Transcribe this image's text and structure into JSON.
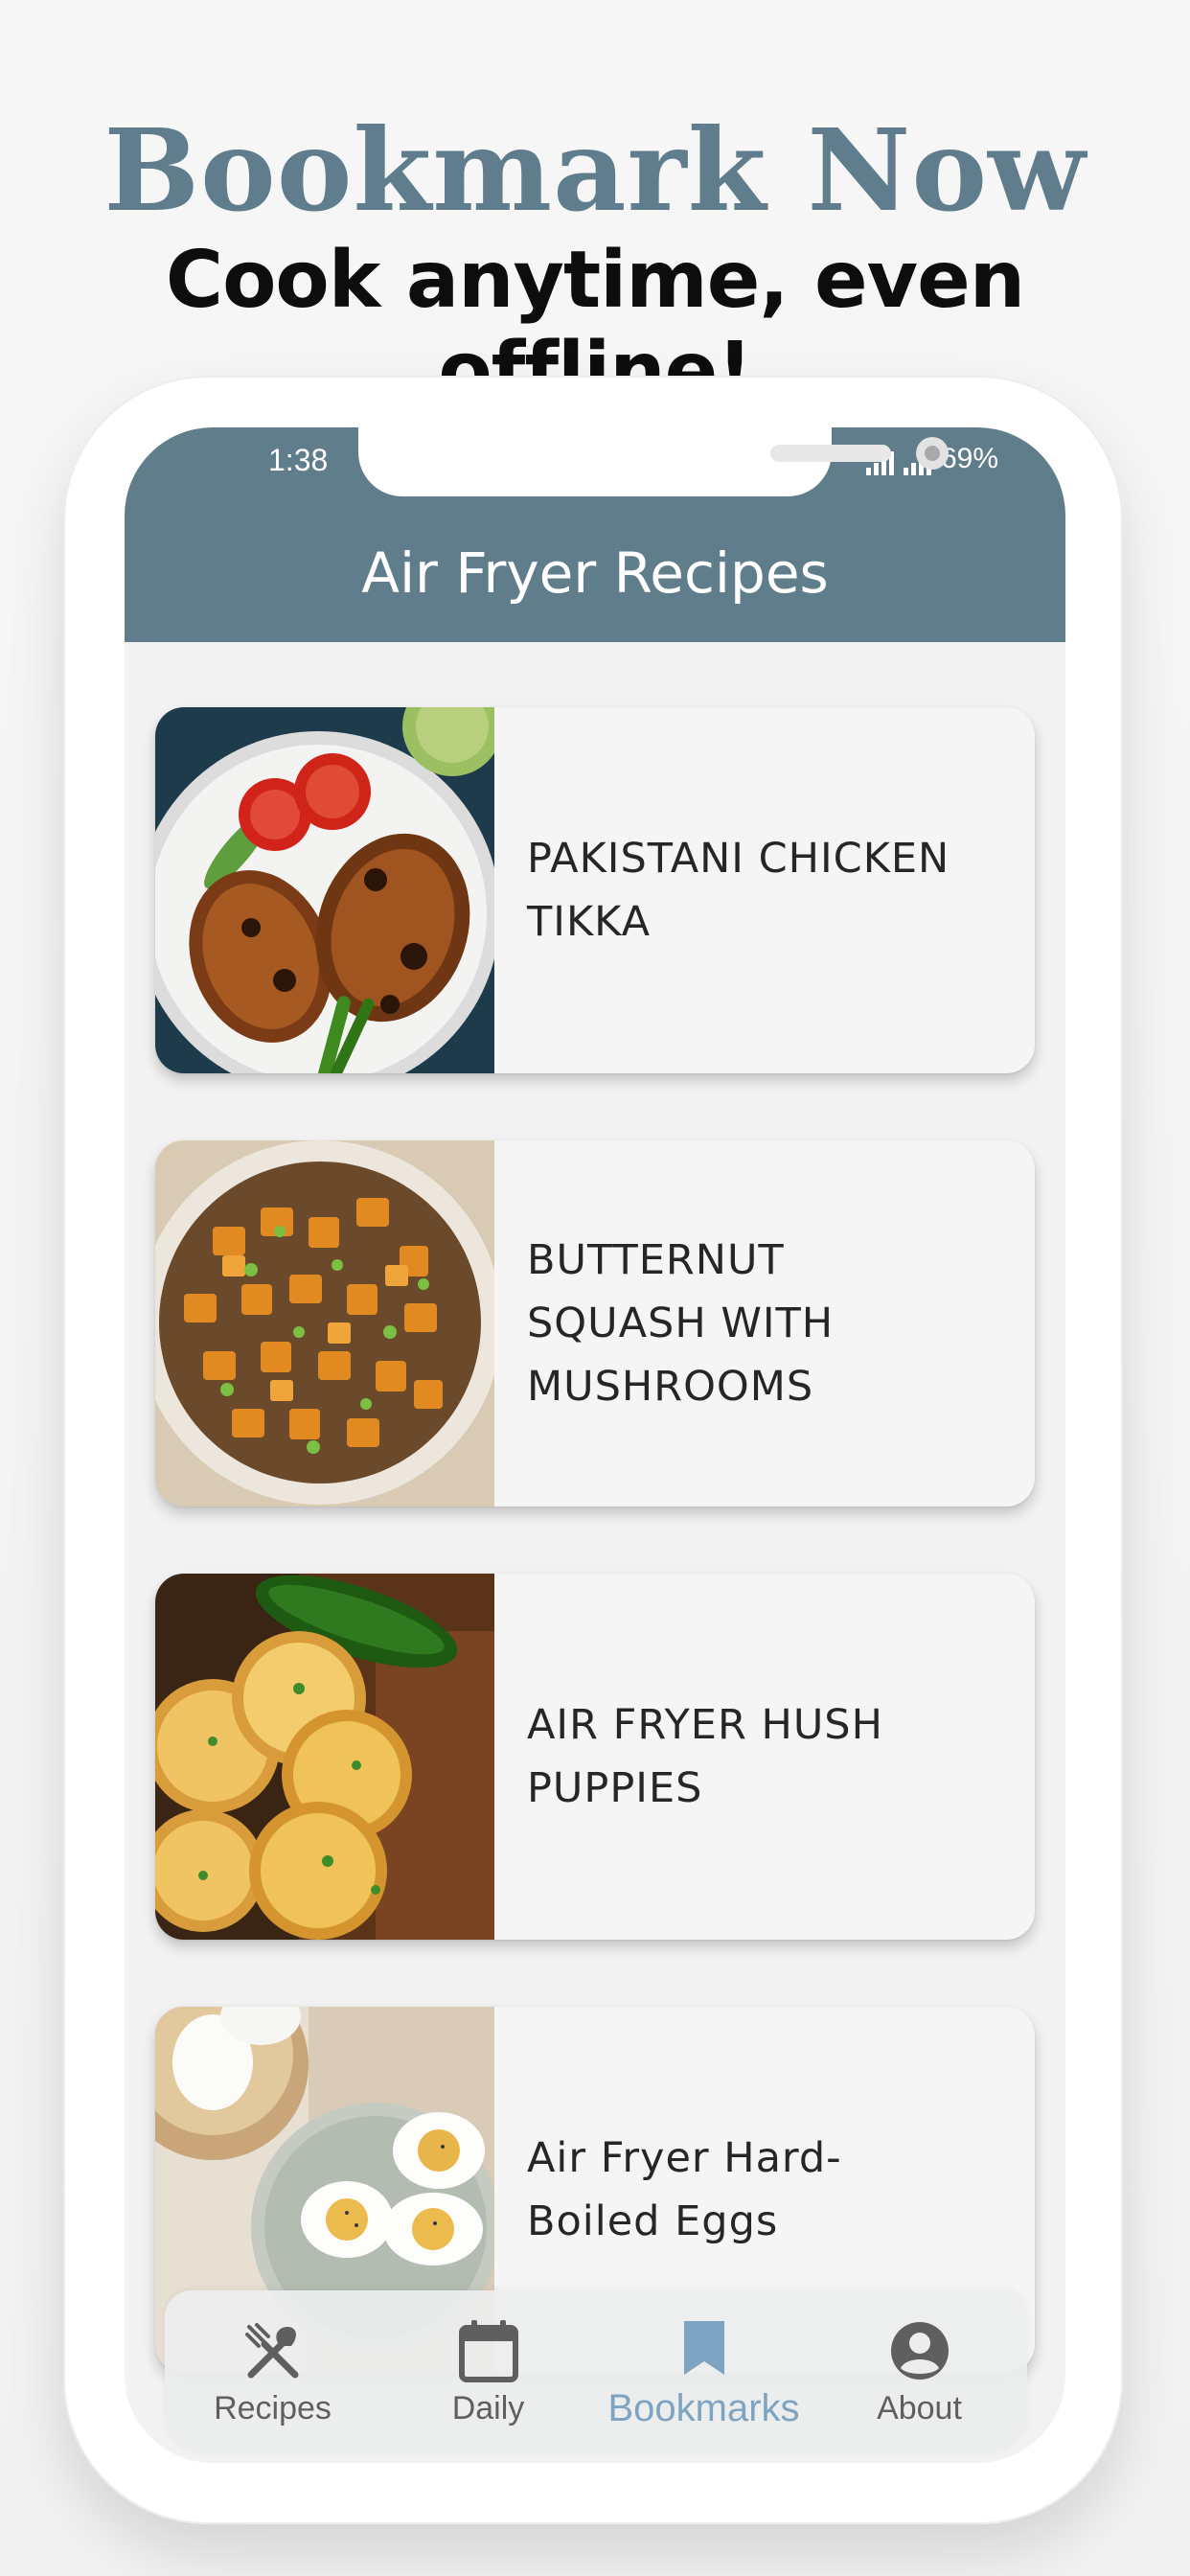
{
  "promo": {
    "headline": "Bookmark Now",
    "subline": "Cook anytime, even offline!"
  },
  "status_bar": {
    "time": "1:38",
    "battery": "69%"
  },
  "app_bar": {
    "title": "Air Fryer Recipes"
  },
  "recipes": [
    {
      "title_line1": "PAKISTANI CHICKEN",
      "title_line2": "TIKKA",
      "title_line3": "",
      "image": "grilled-chicken-photo"
    },
    {
      "title_line1": "BUTTERNUT",
      "title_line2": "SQUASH WITH",
      "title_line3": "MUSHROOMS",
      "image": "squash-mushroom-photo"
    },
    {
      "title_line1": "AIR FRYER HUSH",
      "title_line2": "PUPPIES",
      "title_line3": "",
      "image": "hush-puppies-photo"
    },
    {
      "title_line1": "Air Fryer Hard-",
      "title_line2": "Boiled Eggs",
      "title_line3": "",
      "image": "boiled-eggs-photo"
    }
  ],
  "bottom_nav": {
    "items": [
      {
        "label": "Recipes",
        "icon": "fork-knife-icon"
      },
      {
        "label": "Daily",
        "icon": "calendar-icon"
      },
      {
        "label": "Bookmarks",
        "icon": "bookmark-icon",
        "active": true
      },
      {
        "label": "About",
        "icon": "account-circle-icon"
      }
    ]
  },
  "colors": {
    "brand": "#607d8b",
    "headline": "#5f7d8c",
    "active_nav": "#7fa4c1"
  }
}
